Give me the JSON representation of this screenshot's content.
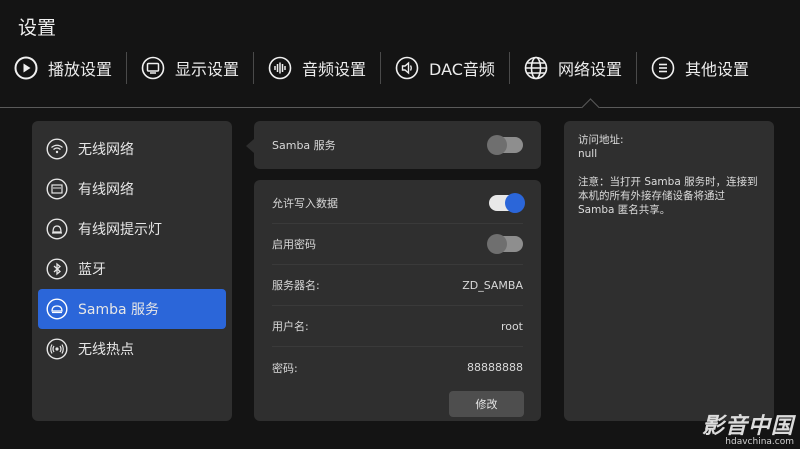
{
  "page_title": "设置",
  "top_nav": [
    {
      "label": "播放设置",
      "icon": "play-circle-icon"
    },
    {
      "label": "显示设置",
      "icon": "monitor-icon"
    },
    {
      "label": "音频设置",
      "icon": "audio-wave-icon"
    },
    {
      "label": "DAC音频",
      "icon": "speaker-icon"
    },
    {
      "label": "网络设置",
      "icon": "globe-icon",
      "active": true
    },
    {
      "label": "其他设置",
      "icon": "menu-circle-icon"
    }
  ],
  "sidebar": {
    "items": [
      {
        "label": "无线网络",
        "icon": "wifi-icon"
      },
      {
        "label": "有线网络",
        "icon": "ethernet-icon"
      },
      {
        "label": "有线网提示灯",
        "icon": "indicator-light-icon"
      },
      {
        "label": "蓝牙",
        "icon": "bluetooth-icon"
      },
      {
        "label": "Samba 服务",
        "icon": "samba-icon",
        "active": true
      },
      {
        "label": "无线热点",
        "icon": "hotspot-icon"
      }
    ]
  },
  "samba": {
    "label": "Samba 服务",
    "enabled": false
  },
  "settings": {
    "allow_write_label": "允许写入数据",
    "allow_write_enabled": true,
    "enable_password_label": "启用密码",
    "enable_password_enabled": false,
    "server_name_label": "服务器名:",
    "server_name_value": "ZD_SAMBA",
    "username_label": "用户名:",
    "username_value": "root",
    "password_label": "密码:",
    "password_value": "88888888",
    "edit_button": "修改"
  },
  "info": {
    "address_label": "访问地址:",
    "address_value": "null",
    "note": "注意：当打开 Samba 服务时，连接到本机的所有外接存储设备将通过 Samba 匿名共享。"
  },
  "watermark": {
    "logo": "影音中国",
    "url": "hdavchina.com"
  },
  "colors": {
    "accent": "#2b66d9",
    "background": "#141414",
    "panel": "#2f2f2f"
  }
}
